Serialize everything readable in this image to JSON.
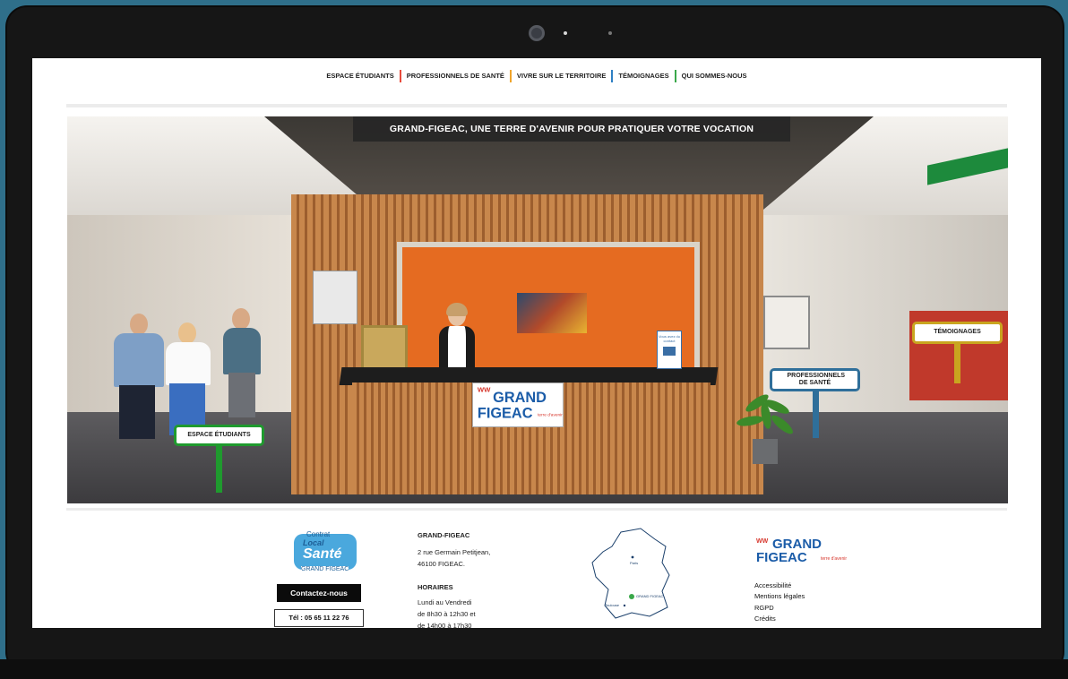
{
  "nav": {
    "items": [
      {
        "label": "ESPACE ÉTUDIANTS",
        "color": "#e84b3c"
      },
      {
        "label": "PROFESSIONNELS DE SANTÉ",
        "color": "#f0a52c"
      },
      {
        "label": "VIVRE SUR LE TERRITOIRE",
        "color": "#2f80c4"
      },
      {
        "label": "TÉMOIGNAGES",
        "color": "#3aa84a"
      },
      {
        "label": "QUI SOMMES-NOUS",
        "color": ""
      }
    ]
  },
  "hero": {
    "title": "GRAND-FIGEAC, UNE TERRE D'AVENIR POUR PRATIQUER VOTRE VOCATION",
    "hotspots": {
      "students": {
        "label": "ESPACE ÉTUDIANTS",
        "color": "#1f9a2e"
      },
      "professionals": {
        "label": "PROFESSIONNELS DE SANTÉ",
        "color": "#2f6f9a"
      },
      "testimonials": {
        "label": "TÉMOIGNAGES",
        "color": "#c9a51f"
      }
    },
    "logo": {
      "line1": "GRAND",
      "line2": "FIGEAC",
      "tag": "terre d'avenir"
    },
    "voucher_text": "Vous avez du contact"
  },
  "footer": {
    "cls_logo": {
      "top": "Contrat",
      "local": "Local",
      "sante": "Santé",
      "bottom": "GRAND FIGEAC"
    },
    "contact_button": "Contactez-nous",
    "phone": "Tél : 05 65 11 22 76",
    "org_title": "GRAND-FIGEAC",
    "address_line1": "2 rue Germain Petitjean,",
    "address_line2": "46100 FIGEAC.",
    "hours_title": "HORAIRES",
    "hours_line1": "Lundi au Vendredi",
    "hours_line2": "de 8h30 à 12h30 et",
    "hours_line3": "de 14h00 à 17h30",
    "map": {
      "paris": "Paris",
      "toulouse": "Toulouse",
      "gf": "GRAND FIGEAC"
    },
    "gf_logo": {
      "line1": "GRAND",
      "line2": "FIGEAC",
      "tag": "terre d'avenir"
    },
    "links": [
      "Accessibilité",
      "Mentions légales",
      "RGPD",
      "Crédits"
    ]
  }
}
